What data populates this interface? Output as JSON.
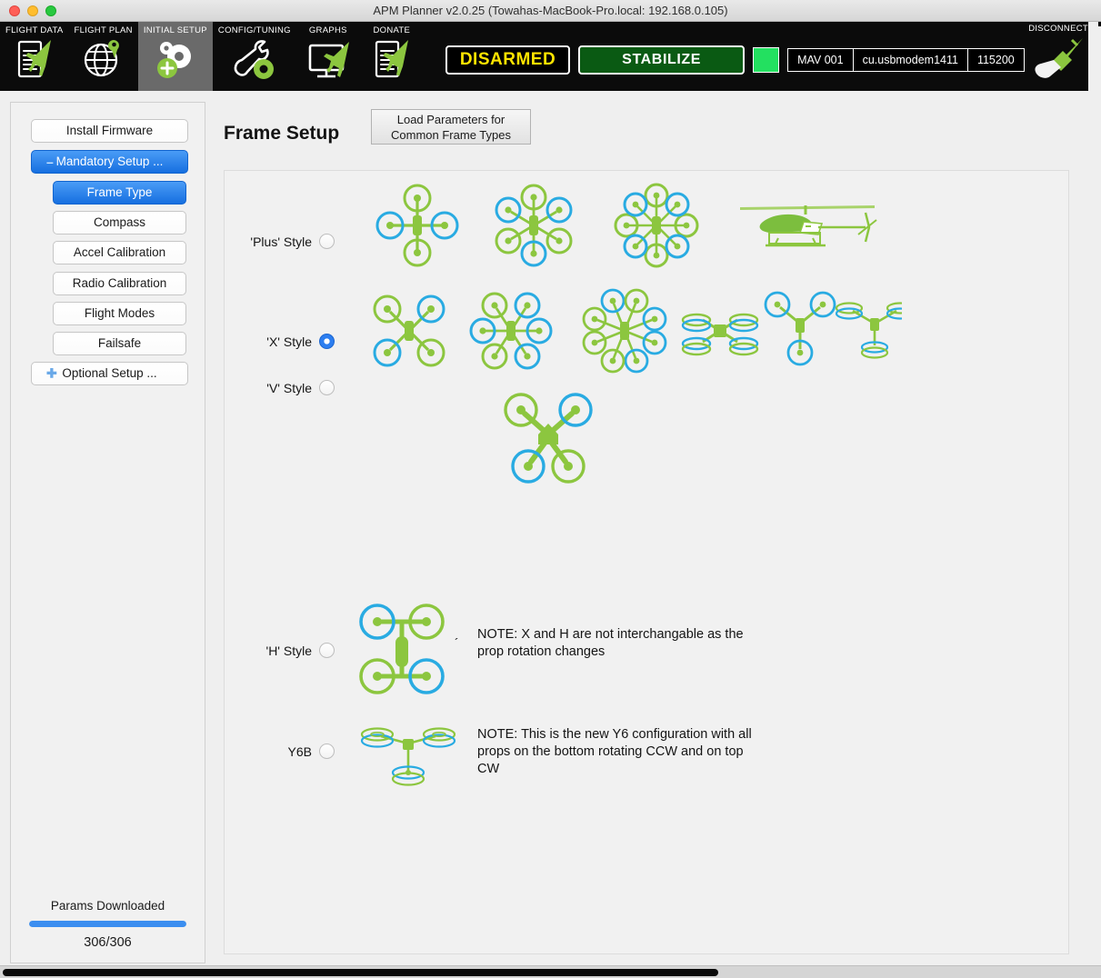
{
  "window": {
    "title": "APM Planner v2.0.25 (Towahas-MacBook-Pro.local: 192.168.0.105)",
    "traffic_lights": [
      "close",
      "minimize",
      "zoom"
    ]
  },
  "toolbar": {
    "tabs": [
      {
        "label": "FLIGHT DATA",
        "icon": "flight-data-icon",
        "active": false
      },
      {
        "label": "FLIGHT PLAN",
        "icon": "flight-plan-icon",
        "active": false
      },
      {
        "label": "INITIAL SETUP",
        "icon": "initial-setup-icon",
        "active": true
      },
      {
        "label": "CONFIG/TUNING",
        "icon": "config-tuning-icon",
        "active": false
      },
      {
        "label": "GRAPHS",
        "icon": "graphs-icon",
        "active": false
      },
      {
        "label": "DONATE",
        "icon": "donate-icon",
        "active": false
      }
    ],
    "arm_status": "DISARMED",
    "flight_mode": "STABILIZE",
    "link_indicator_color": "#23e060",
    "mav_id": "MAV 001",
    "serial_port": "cu.usbmodem1411",
    "baud_rate": "115200",
    "disconnect_label": "DISCONNECT",
    "disconnect_icon": "plug-icon"
  },
  "sidebar": {
    "items": [
      {
        "label": "Install Firmware",
        "style": "top",
        "state": "normal"
      },
      {
        "label": "Mandatory Setup ...",
        "style": "top",
        "state": "selected",
        "prefix": "–"
      },
      {
        "label": "Frame Type",
        "style": "indent",
        "state": "selected"
      },
      {
        "label": "Compass",
        "style": "indent",
        "state": "normal"
      },
      {
        "label": "Accel Calibration",
        "style": "indent",
        "state": "normal"
      },
      {
        "label": "Radio Calibration",
        "style": "indent",
        "state": "normal"
      },
      {
        "label": "Flight Modes",
        "style": "indent",
        "state": "normal"
      },
      {
        "label": "Failsafe",
        "style": "indent",
        "state": "normal"
      },
      {
        "label": "Optional Setup ...",
        "style": "top",
        "state": "normal",
        "prefix": "✚"
      }
    ],
    "progress": {
      "label": "Params Downloaded",
      "count": "306/306",
      "percent": 100,
      "bar_color": "#3b8ef0"
    }
  },
  "main": {
    "page_title": "Frame Setup",
    "load_params_button": "Load Parameters for\nCommon Frame Types",
    "load_params_line1": "Load Parameters for",
    "load_params_line2": "Common Frame Types",
    "frame_rows": [
      {
        "label": "'Plus' Style",
        "selected": false,
        "note": "",
        "diagrams": [
          "quad-plus",
          "hexa-plus",
          "octa-plus",
          "helicopter"
        ]
      },
      {
        "label": "'X' Style",
        "selected": true,
        "note": "",
        "diagrams": [
          "quad-x",
          "hexa-x",
          "octa-x",
          "quad-x-coax",
          "tri-y",
          "y6"
        ]
      },
      {
        "label": "'V' Style",
        "selected": false,
        "note": "",
        "diagrams": [
          "quad-v"
        ]
      },
      {
        "label": "'H' Style",
        "selected": false,
        "note": "NOTE: X and H are not interchangable as the prop rotation changes",
        "note_line1": "NOTE: X and H are not interchangable as the",
        "note_line2": "prop rotation changes",
        "tick_mark": "´",
        "diagrams": [
          "quad-h"
        ]
      },
      {
        "label": "Y6B",
        "selected": false,
        "note": "NOTE: This is the new Y6 configuration with all props on the bottom rotating CCW and on top CW",
        "note_line1": "NOTE: This is the new Y6 configuration with all",
        "note_line2": "props on the bottom rotating CCW and on top",
        "note_line3": "CW",
        "diagrams": [
          "y6b"
        ]
      }
    ]
  },
  "colors": {
    "prop_green": "#8cc63f",
    "prop_blue": "#29abe2",
    "accent_blue": "#2c7ef0",
    "armed_yellow": "#ffe400",
    "mode_green": "#0a5a13"
  }
}
